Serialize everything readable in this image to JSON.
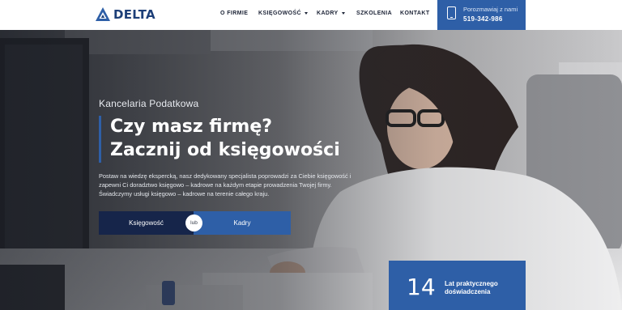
{
  "brand": {
    "name": "DELTA",
    "color": "#1d3f78"
  },
  "nav": {
    "items": [
      {
        "label": "O FIRMIE"
      },
      {
        "label": "KSIĘGOWOŚĆ"
      },
      {
        "label": "KADRY"
      },
      {
        "label": "SZKOLENIA"
      },
      {
        "label": "KONTAKT"
      }
    ]
  },
  "contact": {
    "label": "Porozmawiaj z nami",
    "phone": "519-342-986",
    "icon": "phone-icon"
  },
  "hero": {
    "kicker": "Kancelaria Podatkowa",
    "title_line1": "Czy masz firmę?",
    "title_line2": "Zacznij od księgowości",
    "description": "Postaw na wiedzę ekspercką, nasz dedykowany specjalista poprowadzi za Ciebie księgowość i zapewni Ci doradztwo księgowo – kadrowe na każdym etapie prowadzenia Twojej firmy. Świadczymy usługi księgowo – kadrowe na terenie całego kraju.",
    "cta_primary": "Księgowość",
    "cta_or": "lub",
    "cta_secondary": "Kadry"
  },
  "stats": {
    "number": "14",
    "label": "Lat praktycznego doświadczenia"
  },
  "colors": {
    "accent": "#2e5fa7",
    "dark": "#16254a"
  }
}
